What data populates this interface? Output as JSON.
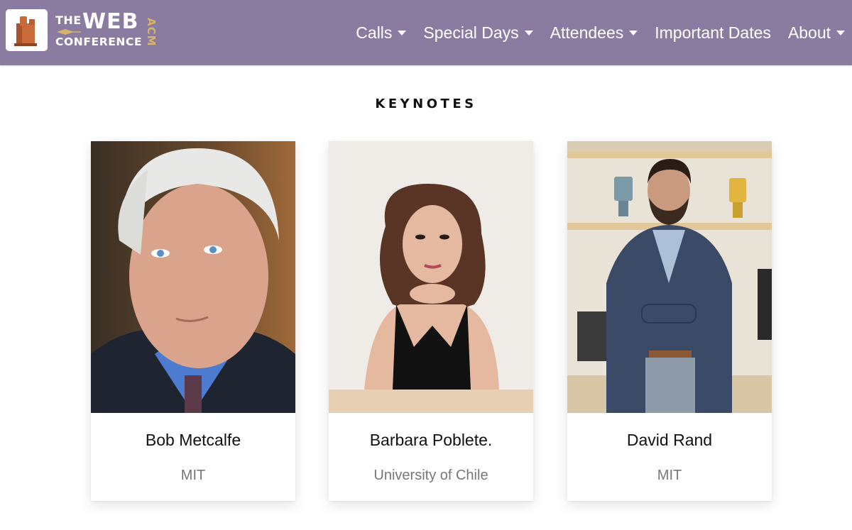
{
  "header": {
    "logo": {
      "line1": "THE",
      "line2": "WEB",
      "line3": "CONFERENCE",
      "badge": "ACM"
    },
    "nav": [
      {
        "label": "Calls",
        "dropdown": true
      },
      {
        "label": "Special Days",
        "dropdown": true
      },
      {
        "label": "Attendees",
        "dropdown": true
      },
      {
        "label": "Important Dates",
        "dropdown": false
      },
      {
        "label": "About",
        "dropdown": true
      }
    ]
  },
  "section": {
    "title": "KEYNOTES"
  },
  "keynotes": [
    {
      "name": "Bob Metcalfe",
      "affiliation": "MIT"
    },
    {
      "name": "Barbara Poblete.",
      "affiliation": "University of Chile"
    },
    {
      "name": "David Rand",
      "affiliation": "MIT"
    }
  ],
  "colors": {
    "navbar": "#8a7ba0",
    "nav_text": "#ffffff",
    "logo_gold": "#d6b56a",
    "logo_orange": "#c86a3a",
    "affiliation_text": "#777777"
  }
}
